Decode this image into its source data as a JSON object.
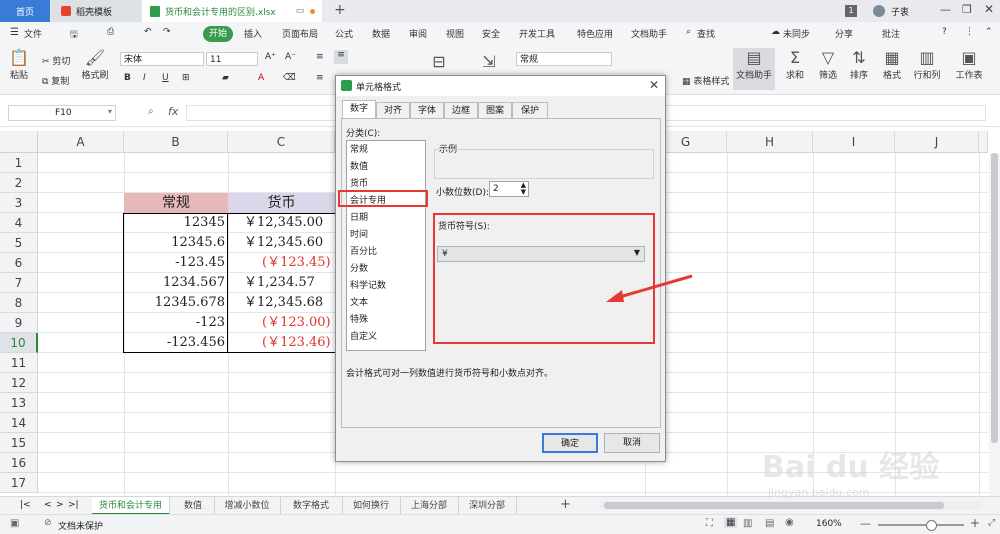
{
  "titlebar": {
    "home_tab": "首页",
    "docer_tab": "稻壳模板",
    "file_tab": "货币和会计专用的区别.xlsx",
    "new_tab": "+",
    "page_count": "1",
    "user": "子衷"
  },
  "menubar": {
    "file": "文件",
    "start": "开始",
    "items": [
      "插入",
      "页面布局",
      "公式",
      "数据",
      "审阅",
      "视图",
      "安全",
      "开发工具",
      "特色应用",
      "文档助手"
    ],
    "search": "查找",
    "sync": "未同步",
    "share": "分享",
    "comment": "批注"
  },
  "ribbon": {
    "paste": "粘贴",
    "cut": "剪切",
    "copy": "复制",
    "format_painter": "格式刷",
    "font_name": "宋体",
    "font_size": "11",
    "number_format": "常规",
    "table_style": "表格样式",
    "doc_helper": "文档助手",
    "sum": "求和",
    "filter": "筛选",
    "sort": "排序",
    "format": "格式",
    "rows_cols": "行和列",
    "worksheet": "工作表"
  },
  "formula_bar": {
    "cell_ref": "F10",
    "fx": "fx",
    "value": ""
  },
  "grid": {
    "columns": [
      "A",
      "B",
      "C",
      "G",
      "H",
      "I",
      "J"
    ],
    "rows": [
      "1",
      "2",
      "3",
      "4",
      "5",
      "6",
      "7",
      "8",
      "9",
      "10",
      "11",
      "12",
      "13",
      "14",
      "15",
      "16",
      "17"
    ],
    "header_general": "常规",
    "header_currency": "货币",
    "col_b": [
      "12345",
      "12345.6",
      "-123.45",
      "1234.567",
      "12345.678",
      "-123",
      "-123.456"
    ],
    "col_c": [
      "￥12,345.00",
      "￥12,345.60",
      "(￥123.45)",
      "￥1,234.57",
      "￥12,345.68",
      "(￥123.00)",
      "(￥123.46)"
    ],
    "neg_color": "#e0342c"
  },
  "dialog": {
    "title": "单元格格式",
    "tabs": [
      "数字",
      "对齐",
      "字体",
      "边框",
      "图案",
      "保护"
    ],
    "category_label": "分类(C):",
    "categories": [
      "常规",
      "数值",
      "货币",
      "会计专用",
      "日期",
      "时间",
      "百分比",
      "分数",
      "科学记数",
      "文本",
      "特殊",
      "自定义"
    ],
    "selected_category": "会计专用",
    "sample_label": "示例",
    "decimal_label": "小数位数(D):",
    "decimal_value": "2",
    "currency_label": "货币符号(S):",
    "currency_value": "¥",
    "description": "会计格式可对一列数值进行货币符号和小数点对齐。",
    "ok": "确定",
    "cancel": "取消",
    "highlight_color": "#e53935"
  },
  "sheet_tabs": {
    "tabs": [
      "货币和会计专用",
      "数值",
      "增减小数位",
      "数字格式",
      "如何换行",
      "上海分部",
      "深圳分部"
    ],
    "active": "货币和会计专用",
    "add": "+"
  },
  "statusbar": {
    "protect": "文档未保护",
    "zoom": "160%"
  },
  "watermark": {
    "brand": "Bai du 经验",
    "url": "jingyan.baidu.com"
  }
}
